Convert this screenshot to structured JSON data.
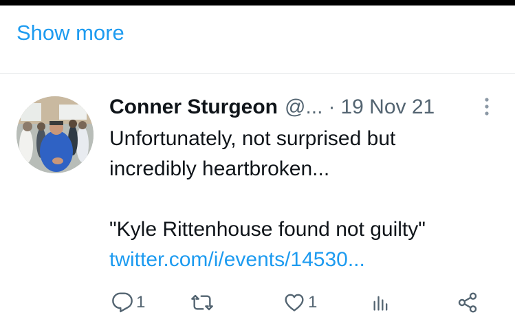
{
  "show_more_label": "Show more",
  "tweet": {
    "author_name": "Conner Sturgeon",
    "author_handle": "@...",
    "separator": "·",
    "date": "19 Nov 21",
    "text_line1": "Unfortunately, not surprised but",
    "text_line2": "incredibly heartbroken...",
    "quote": "\"Kyle Rittenhouse found not guilty\"",
    "link": "twitter.com/i/events/14530..."
  },
  "actions": {
    "reply_count": "1",
    "like_count": "1"
  },
  "colors": {
    "accent": "#1d9bf0",
    "text": "#0f1419",
    "muted": "#536471",
    "divider": "#e6e9ea"
  },
  "icons": [
    "more-vertical-icon",
    "reply-icon",
    "retweet-icon",
    "like-icon",
    "views-icon",
    "share-icon"
  ]
}
